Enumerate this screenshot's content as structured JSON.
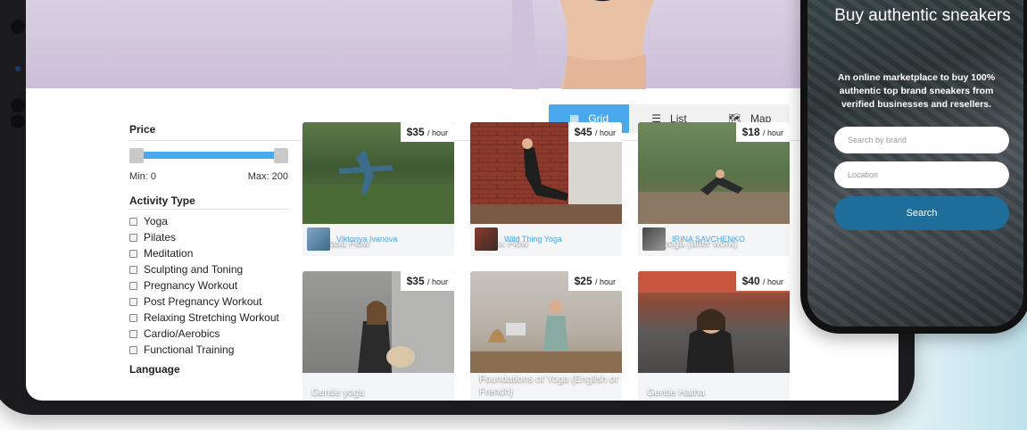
{
  "view_toggle": {
    "grid_label": "Grid",
    "list_label": "List",
    "map_label": "Map",
    "active": "grid"
  },
  "filters": {
    "price_label": "Price",
    "min_label": "Min: 0",
    "max_label": "Max: 200",
    "activity_label": "Activity Type",
    "activities": [
      "Yoga",
      "Pilates",
      "Meditation",
      "Sculpting and Toning",
      "Pregnancy Workout",
      "Post Pregnancy Workout",
      "Relaxing Stretching Workout",
      "Cardio/Aerobics",
      "Functional Training"
    ],
    "language_label": "Language"
  },
  "cards": [
    {
      "price": "$35",
      "unit": "/ hour",
      "title": "Vinyasa Flow",
      "instructor": "Viktoriya Ivanova"
    },
    {
      "price": "$45",
      "unit": "/ hour",
      "title": "Detox Flow",
      "instructor": "Wild Thing Yoga"
    },
    {
      "price": "$18",
      "unit": "/ hour",
      "title": "Yin yoga (after work)",
      "instructor": "IRINA SAVCHENKO"
    },
    {
      "price": "$35",
      "unit": "/ hour",
      "title": "Gentle yoga"
    },
    {
      "price": "$25",
      "unit": "/ hour",
      "title": "Foundations of Yoga (English or French)"
    },
    {
      "price": "$40",
      "unit": "/ hour",
      "title": "Gentle Hatha"
    }
  ],
  "phone": {
    "title": "Buy authentic sneakers",
    "description": "An online marketplace to buy 100% authentic top brand sneakers from verified businesses and resellers.",
    "brand_placeholder": "Search by brand",
    "location_placeholder": "Location",
    "search_label": "Search"
  },
  "colors": {
    "accent": "#4aa8ec",
    "phone_button": "#1f6d9a"
  }
}
